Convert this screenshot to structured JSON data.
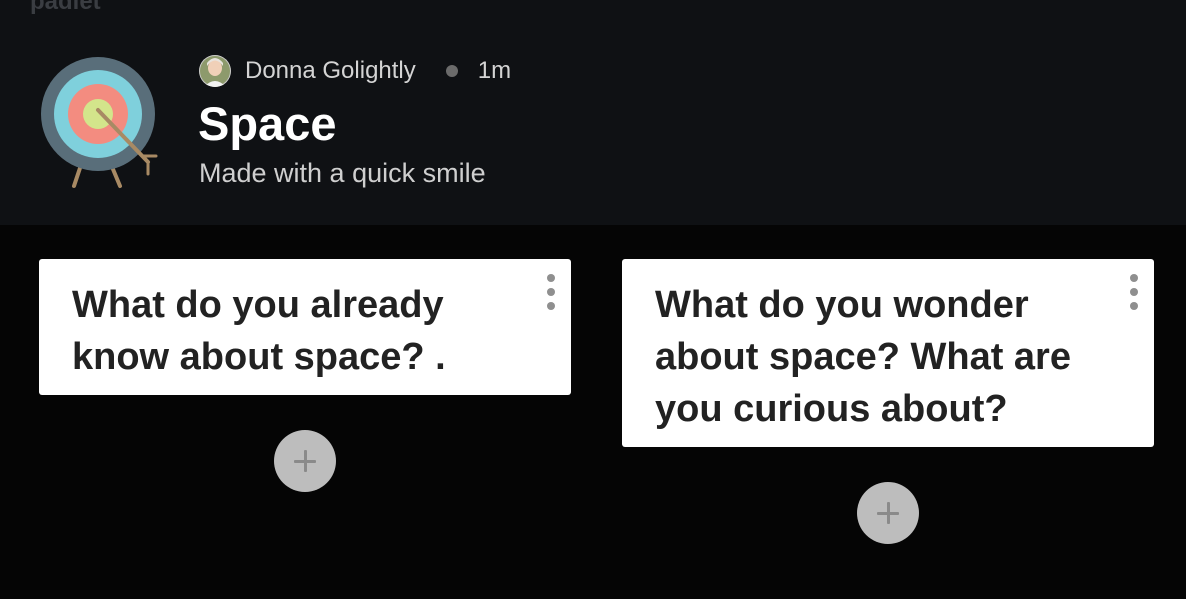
{
  "app": {
    "brand": "padlet"
  },
  "header": {
    "author": "Donna Golightly",
    "time": "1m",
    "title": "Space",
    "subtitle": "Made with a quick smile",
    "icon": "target-with-arrow-icon"
  },
  "columns": [
    {
      "prompt": "What do you already know about space? ."
    },
    {
      "prompt": "What do you wonder about space? What are you curious about?"
    }
  ],
  "colors": {
    "header_bg": "#0f1114",
    "page_bg": "#050505",
    "card_bg": "#ffffff",
    "add_button": "#bdbdbd",
    "target_outer": "#596e7a",
    "target_ring": "#7fd0dc",
    "target_mid": "#f38c80",
    "target_center": "#d3e58b"
  }
}
